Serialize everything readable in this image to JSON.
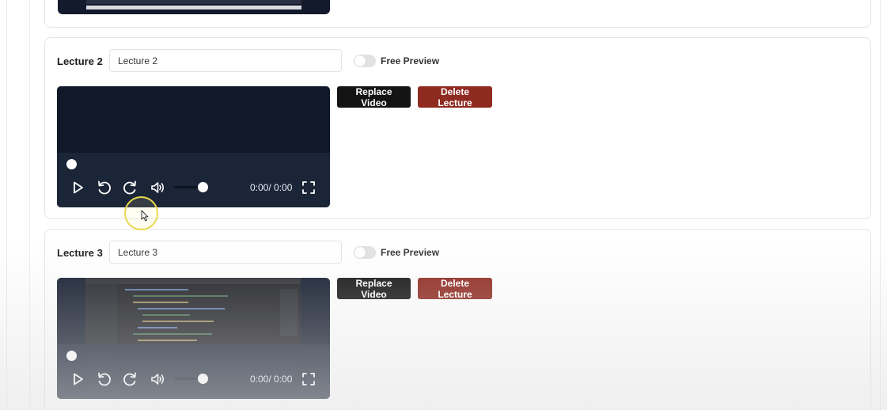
{
  "lectures": [
    {
      "label": "Lecture 2",
      "title_value": "Lecture 2",
      "free_preview_label": "Free Preview",
      "free_preview_on": false,
      "player": {
        "time": "0:00/ 0:00",
        "progress": 0,
        "volume": 1
      },
      "replace_label": "Replace Video",
      "delete_label": "Delete Lecture"
    },
    {
      "label": "Lecture 3",
      "title_value": "Lecture 3",
      "free_preview_label": "Free Preview",
      "free_preview_on": false,
      "player": {
        "time": "0:00/ 0:00",
        "progress": 0,
        "volume": 1
      },
      "replace_label": "Replace Video",
      "delete_label": "Delete Lecture"
    }
  ],
  "colors": {
    "replace_button": "#141414",
    "delete_button": "#8f2a21",
    "player_bg": "#121a2c",
    "toggle_off": "#e2e2e2",
    "cursor_highlight": "#e8d94f"
  },
  "icons": [
    "play-icon",
    "rewind-icon",
    "forward-icon",
    "volume-icon",
    "fullscreen-icon"
  ]
}
